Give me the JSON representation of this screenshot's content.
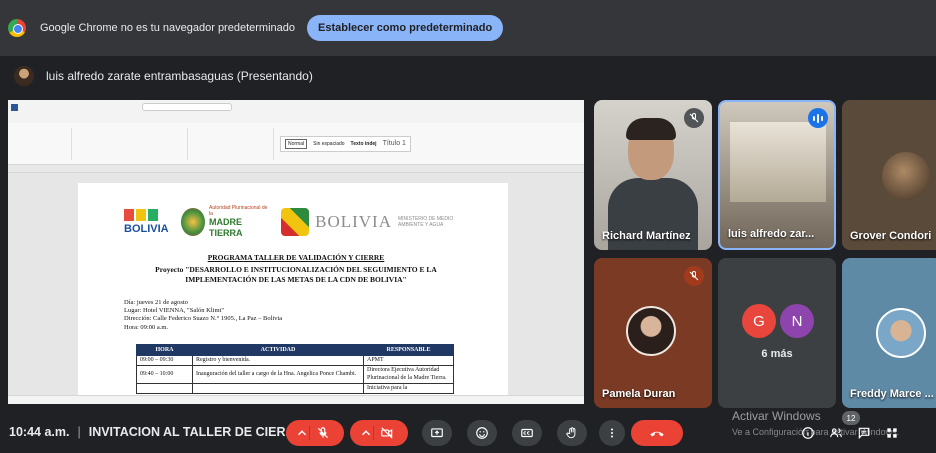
{
  "infobar": {
    "message": "Google Chrome no es tu navegador predeterminado",
    "button_label": "Establecer como predeterminado"
  },
  "presenter": {
    "label": "luis alfredo zarate entrambasaguas (Presentando)"
  },
  "shared_screen": {
    "ribbon": {
      "styles": [
        "Normal",
        "Sin espaciado",
        "Texto indej",
        "Título 1"
      ]
    },
    "document": {
      "logo_bolivia": "BOLIVIA",
      "logo_mt_top": "Autoridad Plurinacional de la",
      "logo_mt_main": "MADRE TIERRA",
      "logo_bol2_word": "BOLIVIA",
      "logo_bol2_ministry": "MINISTERIO DE MEDIO AMBIENTE Y AGUA",
      "heading": "PROGRAMA TALLER DE VALIDACIÓN Y CIERRE",
      "project": "Proyecto \"DESARROLLO E INSTITUCIONALIZACIÓN DEL SEGUIMIENTO E LA IMPLEMENTACIÓN DE LAS METAS DE LA CDN DE BOLIVIA\"",
      "date_line": "Día: jueves 21 de agosto",
      "place_line": "Lugar: Hotel VIENNA, \"Salón Klimt\"",
      "address_line": "Dirección: Calle Federico Suazo N.° 1905., La Paz – Bolivia",
      "time_line": "Hora: 09:00 a.m.",
      "table_headers": [
        "HORA",
        "ACTIVIDAD",
        "RESPONSABLE"
      ],
      "table_rows": [
        [
          "09:00 – 09:30",
          "Registro y bienvenida.",
          "APMT"
        ],
        [
          "09:40 – 10:00",
          "Inauguración del taller a cargo de la Hna. Angelica Ponce Chambi.",
          "Directora Ejecutiva Autoridad Plurinacional de la Madre Tierra."
        ],
        [
          "",
          "",
          "Iniciativa para la"
        ]
      ]
    }
  },
  "participants": [
    {
      "name": "Richard Martínez",
      "muted": true
    },
    {
      "name": "luis alfredo zar...",
      "speaking": true
    },
    {
      "name": "Grover Condori"
    },
    {
      "name": "Pamela Duran",
      "muted": true
    },
    {
      "name": "Freddy Marce ..."
    }
  ],
  "more_tile": {
    "bubbles": [
      {
        "letter": "G",
        "color": "#e8453c"
      },
      {
        "letter": "N",
        "color": "#8e44ad"
      }
    ],
    "label": "6 más"
  },
  "bottom_bar": {
    "time": "10:44 a.m.",
    "meeting_title": "INVITACION AL TALLER DE CIER...",
    "participant_count": "12"
  },
  "watermark": {
    "line1": "Activar Windows",
    "line2": "Ve a Configuración para activar Windows."
  }
}
